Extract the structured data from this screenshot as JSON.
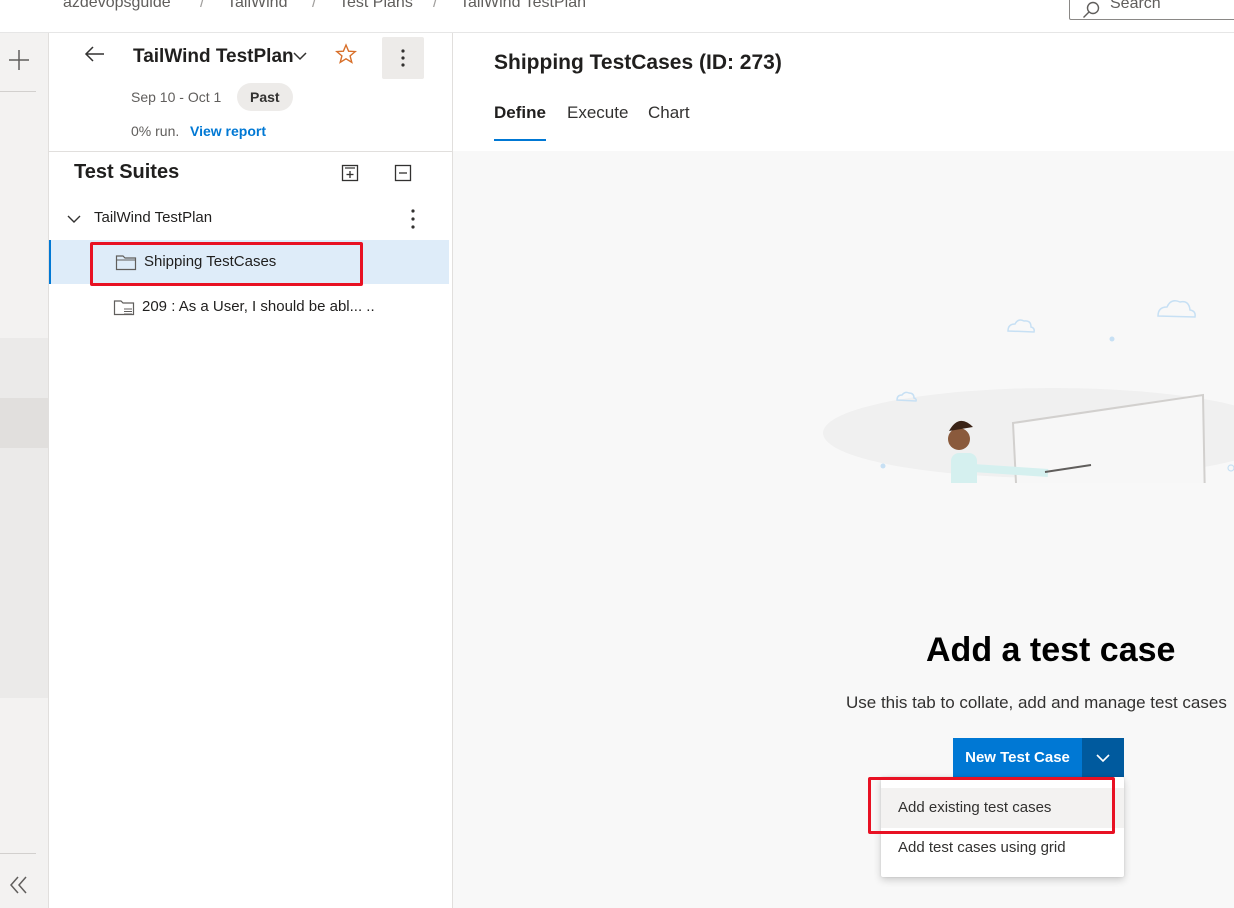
{
  "breadcrumb": {
    "items": [
      "azdevopsguide",
      "TailWind",
      "Test Plans",
      "TailWind TestPlan"
    ],
    "separator": "/"
  },
  "search": {
    "placeholder": "Search",
    "icon": "search-icon"
  },
  "rail": {
    "add_icon": "plus-icon",
    "collapse_icon": "double-chevron-left-icon"
  },
  "plan": {
    "title": "TailWind TestPlan",
    "dates": "Sep 10 - Oct 1",
    "status_badge": "Past",
    "run_text": "0% run.",
    "report_link": "View report"
  },
  "suites": {
    "heading": "Test Suites",
    "root": "TailWind TestPlan",
    "selected": "Shipping TestCases",
    "child": "209 : As a User, I should be abl... .."
  },
  "main": {
    "title": "Shipping TestCases (ID: 273)",
    "tabs": [
      "Define",
      "Execute",
      "Chart"
    ],
    "active_tab": "Define"
  },
  "empty_state": {
    "title": "Add a test case",
    "description": "Use this tab to collate, add and manage test cases"
  },
  "new_test_case": {
    "button_label": "New Test Case",
    "menu": [
      "Add existing test cases",
      "Add test cases using grid"
    ]
  },
  "colors": {
    "accent": "#0078d4",
    "highlight": "#e81123",
    "selected_row": "#deecf9",
    "star": "#d86f29"
  }
}
